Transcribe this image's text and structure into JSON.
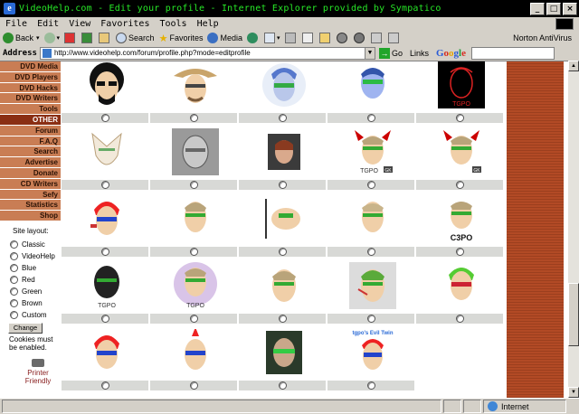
{
  "window": {
    "title": "VideoHelp.com - Edit your profile - Internet Explorer provided by Sympatico"
  },
  "menu": [
    "File",
    "Edit",
    "View",
    "Favorites",
    "Tools",
    "Help"
  ],
  "toolbar": {
    "back": "Back",
    "search": "Search",
    "favorites": "Favorites",
    "media": "Media",
    "norton": "Norton AntiVirus"
  },
  "address": {
    "label": "Address",
    "url": "http://www.videohelp.com/forum/profile.php?mode=editprofile",
    "go": "Go",
    "links": "Links",
    "google": [
      "G",
      "o",
      "o",
      "g",
      "l",
      "e"
    ]
  },
  "sidebar": {
    "nav": [
      "DVD Media",
      "DVD Players",
      "DVD Hacks",
      "DVD Writers",
      "Tools",
      "OTHER",
      "Forum",
      "F.A.Q",
      "Search",
      "Advertise",
      "Donate",
      "CD Writers",
      "Sefy",
      "Statistics",
      "Shop"
    ],
    "active_index": 5,
    "layout_title": "Site layout:",
    "layout_options": [
      "Classic",
      "VideoHelp",
      "Blue",
      "Red",
      "Green",
      "Brown",
      "Custom"
    ],
    "change_label": "Change",
    "cookies_note": "Cookies must be enabled.",
    "printer_label": "Printer Friendly"
  },
  "avatars": {
    "captions": {
      "r0c4": "TGPO",
      "r1c3": "TGPO",
      "r2c4": "C3PO",
      "r3c0": "TGPO",
      "r3c1": "TGPO",
      "r4c3": "tgpo's Evil Twin"
    },
    "tag_r1c3": "GK",
    "tag_r1c4": "GK"
  },
  "status": {
    "zone": "Internet"
  },
  "colors": {
    "nav": "#c97d54",
    "nav_active": "#8a2e13",
    "title_text": "#27e827",
    "right_bar": "#b24a25"
  }
}
